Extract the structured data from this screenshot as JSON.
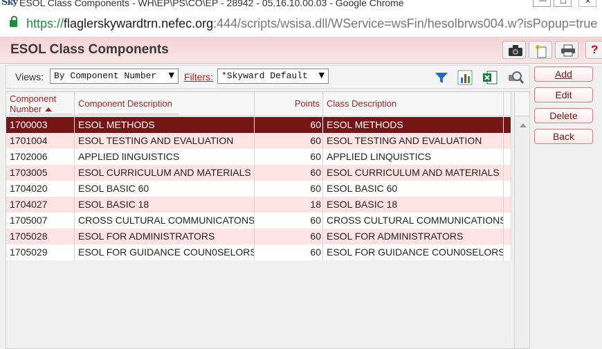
{
  "window": {
    "logo": "Sky",
    "title": "ESOL Class Components - WH\\EP\\PS\\CO\\EP - 28942 - 05.16.10.00.03 - Google Chrome",
    "min_glyph": "—",
    "max_glyph": "☐",
    "close_glyph": "✕"
  },
  "address": {
    "protocol": "https://",
    "host": "flaglerskywardtrn.nefec.org",
    "rest": ":444/scripts/wsisa.dll/WService=wsFin/hesolbrws004.w?isPopup=true"
  },
  "page": {
    "title": "ESOL Class Components",
    "header_icons": [
      "camera-icon",
      "new-document-icon",
      "print-icon",
      "help-icon"
    ],
    "help_glyph": "?"
  },
  "toolbar": {
    "views_label": "Views:",
    "views_value": "By Component Number",
    "filters_label": "Filters:",
    "filters_value": "*Skyward Default",
    "dropdown_glyph": "▼",
    "tool_icons": [
      "filter-icon",
      "chart-icon",
      "excel-icon",
      "preview-icon"
    ]
  },
  "grid": {
    "headers": {
      "component_number_line1": "Component",
      "component_number_line2": "Number",
      "component_description": "Component Description",
      "points": "Points",
      "class_description": "Class Description"
    },
    "rows": [
      {
        "number": "1700003",
        "description": "ESOL METHODS",
        "points": "60",
        "class": "ESOL METHODS"
      },
      {
        "number": "1701004",
        "description": "ESOL TESTING AND EVALUATION",
        "points": "60",
        "class": "ESOL TESTING AND EVALUATION"
      },
      {
        "number": "1702006",
        "description": "APPLIED lINGUISTICS",
        "points": "60",
        "class": "APPLIED LINQUISTICS"
      },
      {
        "number": "1703005",
        "description": "ESOL CURRICULUM AND MATERIALS",
        "points": "60",
        "class": "ESOL CURRICULUM AND MATERIALS"
      },
      {
        "number": "1704020",
        "description": "ESOL BASIC 60",
        "points": "60",
        "class": "ESOL BASIC 60"
      },
      {
        "number": "1704027",
        "description": "ESOL BASIC 18",
        "points": "18",
        "class": "ESOL BASIC 18"
      },
      {
        "number": "1705007",
        "description": "CROSS CULTURAL COMMUNICATONS",
        "points": "60",
        "class": "CROSS CULTURAL COMMUNICATIONS"
      },
      {
        "number": "1705028",
        "description": "ESOL FOR ADMINISTRATORS",
        "points": "60",
        "class": "ESOL FOR ADMINISTRATORS"
      },
      {
        "number": "1705029",
        "description": "ESOL FOR GUIDANCE COUN0SELORS",
        "points": "60",
        "class": "ESOL FOR GUIDANCE COUN0SELORS"
      }
    ],
    "selected_row": 0
  },
  "actions": {
    "add": "Add",
    "edit": "Edit",
    "delete": "Delete",
    "back": "Back"
  },
  "colors": {
    "selected_row": "#751515",
    "alt_row": "#fde3e3",
    "header_text": "#a82020"
  }
}
